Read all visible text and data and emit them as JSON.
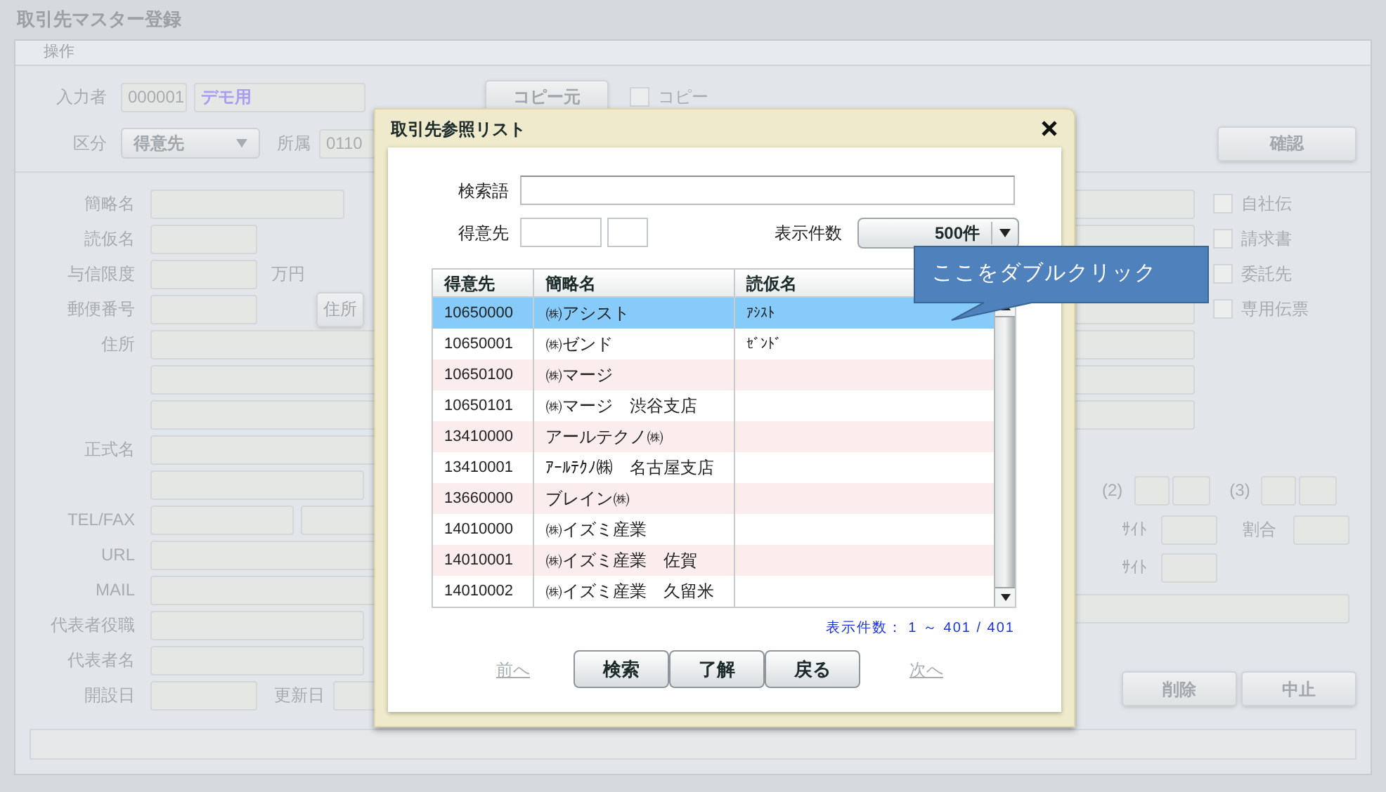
{
  "window": {
    "title": "取引先マスター登録"
  },
  "menu": [
    {
      "label": "操作"
    }
  ],
  "form": {
    "entry_user": {
      "label": "入力者",
      "code": "000001",
      "name": "デモ用"
    },
    "copy_source_button": "コピー元",
    "copy_checkbox": {
      "label": "コピー",
      "checked": false
    },
    "category": {
      "label": "区分",
      "value": "得意先"
    },
    "affiliation": {
      "label": "所属",
      "code": "0110"
    },
    "confirm_button": "確認",
    "left_rows": [
      {
        "kind": "short",
        "label": "簡略名"
      },
      {
        "kind": "small",
        "label": "読仮名"
      },
      {
        "kind": "suffix",
        "label": "与信限度",
        "suffix": "万円"
      },
      {
        "kind": "button",
        "label": "郵便番号",
        "button": "住所"
      },
      {
        "kind": "wide",
        "label": "住所"
      },
      {
        "kind": "wide"
      },
      {
        "kind": "wide"
      },
      {
        "kind": "wide",
        "label": "正式名"
      },
      {
        "kind": "medium"
      },
      {
        "kind": "pair",
        "label": "TEL/FAX"
      },
      {
        "kind": "wide",
        "label": "URL"
      },
      {
        "kind": "wide",
        "label": "MAIL"
      },
      {
        "kind": "medium",
        "label": "代表者役職"
      },
      {
        "kind": "medium",
        "label": "代表者名"
      },
      {
        "kind": "dates",
        "label": "開設日",
        "label2": "更新日"
      }
    ],
    "checkboxes": [
      {
        "label": "自社伝",
        "checked": false
      },
      {
        "label": "請求書",
        "checked": false
      },
      {
        "label": "委託先",
        "checked": false
      },
      {
        "label": "専用伝票",
        "checked": false
      }
    ],
    "terms": {
      "label_2": "(2)",
      "label_3": "(3)",
      "site_1": "ｻｲﾄ",
      "ratio": "割合",
      "site_2": "ｻｲﾄ"
    },
    "footer_buttons": [
      "削除",
      "中止"
    ]
  },
  "dialog": {
    "title": "取引先参照リスト",
    "search": {
      "label": "検索語"
    },
    "customer": {
      "label": "得意先"
    },
    "display_count": {
      "label": "表示件数",
      "value": "500件"
    },
    "table": {
      "columns": [
        "得意先",
        "簡略名",
        "読仮名"
      ],
      "rows": [
        {
          "code": "10650000",
          "short_name": "㈱アシスト",
          "kana": "ｱｼｽﾄ",
          "selected": true
        },
        {
          "code": "10650001",
          "short_name": "㈱ゼンド",
          "kana": "ｾﾞﾝﾄﾞ",
          "selected": false
        },
        {
          "code": "10650100",
          "short_name": "㈱マージ",
          "selected": false
        },
        {
          "code": "10650101",
          "short_name": "㈱マージ　渋谷支店",
          "selected": false
        },
        {
          "code": "13410000",
          "short_name": "アールテクノ㈱",
          "selected": false
        },
        {
          "code": "13410001",
          "short_name": "ｱｰﾙﾃｸﾉ㈱　名古屋支店",
          "selected": false
        },
        {
          "code": "13660000",
          "short_name": "ブレイン㈱",
          "selected": false
        },
        {
          "code": "14010000",
          "short_name": "㈱イズミ産業",
          "selected": false
        },
        {
          "code": "14010001",
          "short_name": "㈱イズミ産業　佐賀",
          "selected": false
        },
        {
          "code": "14010002",
          "short_name": "㈱イズミ産業　久留米",
          "selected": false
        }
      ]
    },
    "count_text": "表示件数： 1 ～ 401 / 401",
    "prev_link": {
      "label": "前へ",
      "disabled": true
    },
    "buttons": [
      "検索",
      "了解",
      "戻る"
    ],
    "next_link": {
      "label": "次へ",
      "disabled": true
    },
    "callout": "ここをダブルクリック"
  }
}
